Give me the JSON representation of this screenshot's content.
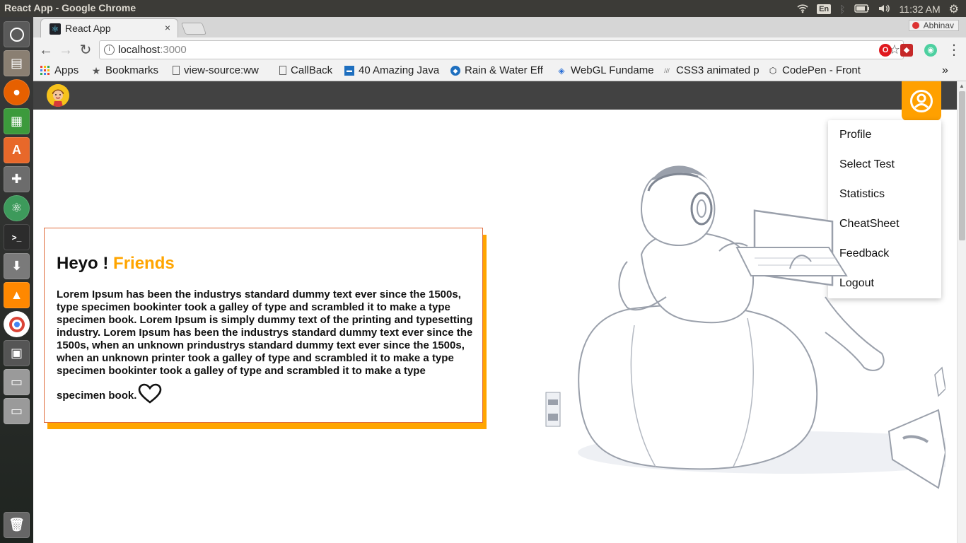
{
  "os": {
    "window_title": "React App - Google Chrome",
    "lang": "En",
    "time": "11:32 AM"
  },
  "browser": {
    "tab_title": "React App",
    "tab_close": "×",
    "user": "Abhinav",
    "url_host": "localhost",
    "url_port": ":3000",
    "bookmarks": [
      {
        "label": "Apps",
        "icon": "apps-grid-icon"
      },
      {
        "label": "Bookmarks",
        "icon": "star-icon"
      },
      {
        "label": "view-source:ww",
        "icon": "page-icon"
      },
      {
        "label": "CallBack",
        "icon": "page-icon"
      },
      {
        "label": "40 Amazing Java",
        "icon": "site-icon"
      },
      {
        "label": "Rain & Water Eff",
        "icon": "site-icon"
      },
      {
        "label": "WebGL Fundame",
        "icon": "cube-icon"
      },
      {
        "label": "CSS3 animated p",
        "icon": "site-icon"
      },
      {
        "label": "CodePen - Front",
        "icon": "codepen-icon"
      }
    ],
    "more_bookmarks": "»"
  },
  "app": {
    "menu": [
      "Profile",
      "Select Test",
      "Statistics",
      "CheatSheet",
      "Feedback",
      "Logout"
    ],
    "card": {
      "greeting": "Heyo !",
      "highlight": "Friends",
      "body": "Lorem Ipsum has been the industrys standard dummy text ever since the 1500s, type specimen bookinter took a galley of type and scrambled it to make a type specimen book. Lorem Ipsum is simply dummy text of the printing and typesetting industry. Lorem Ipsum has been the industrys standard dummy text ever since the 1500s, when an unknown prindustrys standard dummy text ever since the 1500s, when an unknown printer took a galley of type and scrambled it to make a type specimen bookinter took a galley of type and scrambled it to make a type specimen book."
    }
  },
  "colors": {
    "accent": "#ffa500",
    "appbar": "#424242",
    "card_border": "#e06c3c"
  }
}
